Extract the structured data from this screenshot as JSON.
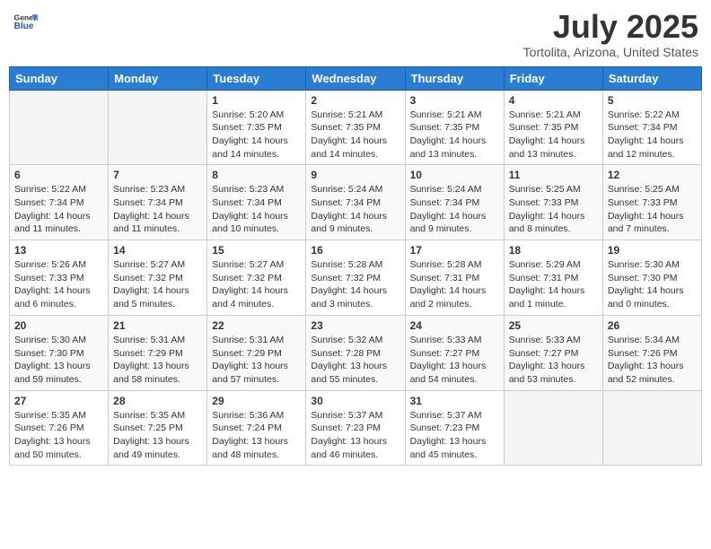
{
  "header": {
    "logo_line1": "General",
    "logo_line2": "Blue",
    "month_title": "July 2025",
    "location": "Tortolita, Arizona, United States"
  },
  "weekdays": [
    "Sunday",
    "Monday",
    "Tuesday",
    "Wednesday",
    "Thursday",
    "Friday",
    "Saturday"
  ],
  "weeks": [
    [
      {
        "day": "",
        "detail": ""
      },
      {
        "day": "",
        "detail": ""
      },
      {
        "day": "1",
        "detail": "Sunrise: 5:20 AM\nSunset: 7:35 PM\nDaylight: 14 hours\nand 14 minutes."
      },
      {
        "day": "2",
        "detail": "Sunrise: 5:21 AM\nSunset: 7:35 PM\nDaylight: 14 hours\nand 14 minutes."
      },
      {
        "day": "3",
        "detail": "Sunrise: 5:21 AM\nSunset: 7:35 PM\nDaylight: 14 hours\nand 13 minutes."
      },
      {
        "day": "4",
        "detail": "Sunrise: 5:21 AM\nSunset: 7:35 PM\nDaylight: 14 hours\nand 13 minutes."
      },
      {
        "day": "5",
        "detail": "Sunrise: 5:22 AM\nSunset: 7:34 PM\nDaylight: 14 hours\nand 12 minutes."
      }
    ],
    [
      {
        "day": "6",
        "detail": "Sunrise: 5:22 AM\nSunset: 7:34 PM\nDaylight: 14 hours\nand 11 minutes."
      },
      {
        "day": "7",
        "detail": "Sunrise: 5:23 AM\nSunset: 7:34 PM\nDaylight: 14 hours\nand 11 minutes."
      },
      {
        "day": "8",
        "detail": "Sunrise: 5:23 AM\nSunset: 7:34 PM\nDaylight: 14 hours\nand 10 minutes."
      },
      {
        "day": "9",
        "detail": "Sunrise: 5:24 AM\nSunset: 7:34 PM\nDaylight: 14 hours\nand 9 minutes."
      },
      {
        "day": "10",
        "detail": "Sunrise: 5:24 AM\nSunset: 7:34 PM\nDaylight: 14 hours\nand 9 minutes."
      },
      {
        "day": "11",
        "detail": "Sunrise: 5:25 AM\nSunset: 7:33 PM\nDaylight: 14 hours\nand 8 minutes."
      },
      {
        "day": "12",
        "detail": "Sunrise: 5:25 AM\nSunset: 7:33 PM\nDaylight: 14 hours\nand 7 minutes."
      }
    ],
    [
      {
        "day": "13",
        "detail": "Sunrise: 5:26 AM\nSunset: 7:33 PM\nDaylight: 14 hours\nand 6 minutes."
      },
      {
        "day": "14",
        "detail": "Sunrise: 5:27 AM\nSunset: 7:32 PM\nDaylight: 14 hours\nand 5 minutes."
      },
      {
        "day": "15",
        "detail": "Sunrise: 5:27 AM\nSunset: 7:32 PM\nDaylight: 14 hours\nand 4 minutes."
      },
      {
        "day": "16",
        "detail": "Sunrise: 5:28 AM\nSunset: 7:32 PM\nDaylight: 14 hours\nand 3 minutes."
      },
      {
        "day": "17",
        "detail": "Sunrise: 5:28 AM\nSunset: 7:31 PM\nDaylight: 14 hours\nand 2 minutes."
      },
      {
        "day": "18",
        "detail": "Sunrise: 5:29 AM\nSunset: 7:31 PM\nDaylight: 14 hours\nand 1 minute."
      },
      {
        "day": "19",
        "detail": "Sunrise: 5:30 AM\nSunset: 7:30 PM\nDaylight: 14 hours\nand 0 minutes."
      }
    ],
    [
      {
        "day": "20",
        "detail": "Sunrise: 5:30 AM\nSunset: 7:30 PM\nDaylight: 13 hours\nand 59 minutes."
      },
      {
        "day": "21",
        "detail": "Sunrise: 5:31 AM\nSunset: 7:29 PM\nDaylight: 13 hours\nand 58 minutes."
      },
      {
        "day": "22",
        "detail": "Sunrise: 5:31 AM\nSunset: 7:29 PM\nDaylight: 13 hours\nand 57 minutes."
      },
      {
        "day": "23",
        "detail": "Sunrise: 5:32 AM\nSunset: 7:28 PM\nDaylight: 13 hours\nand 55 minutes."
      },
      {
        "day": "24",
        "detail": "Sunrise: 5:33 AM\nSunset: 7:27 PM\nDaylight: 13 hours\nand 54 minutes."
      },
      {
        "day": "25",
        "detail": "Sunrise: 5:33 AM\nSunset: 7:27 PM\nDaylight: 13 hours\nand 53 minutes."
      },
      {
        "day": "26",
        "detail": "Sunrise: 5:34 AM\nSunset: 7:26 PM\nDaylight: 13 hours\nand 52 minutes."
      }
    ],
    [
      {
        "day": "27",
        "detail": "Sunrise: 5:35 AM\nSunset: 7:26 PM\nDaylight: 13 hours\nand 50 minutes."
      },
      {
        "day": "28",
        "detail": "Sunrise: 5:35 AM\nSunset: 7:25 PM\nDaylight: 13 hours\nand 49 minutes."
      },
      {
        "day": "29",
        "detail": "Sunrise: 5:36 AM\nSunset: 7:24 PM\nDaylight: 13 hours\nand 48 minutes."
      },
      {
        "day": "30",
        "detail": "Sunrise: 5:37 AM\nSunset: 7:23 PM\nDaylight: 13 hours\nand 46 minutes."
      },
      {
        "day": "31",
        "detail": "Sunrise: 5:37 AM\nSunset: 7:23 PM\nDaylight: 13 hours\nand 45 minutes."
      },
      {
        "day": "",
        "detail": ""
      },
      {
        "day": "",
        "detail": ""
      }
    ]
  ]
}
